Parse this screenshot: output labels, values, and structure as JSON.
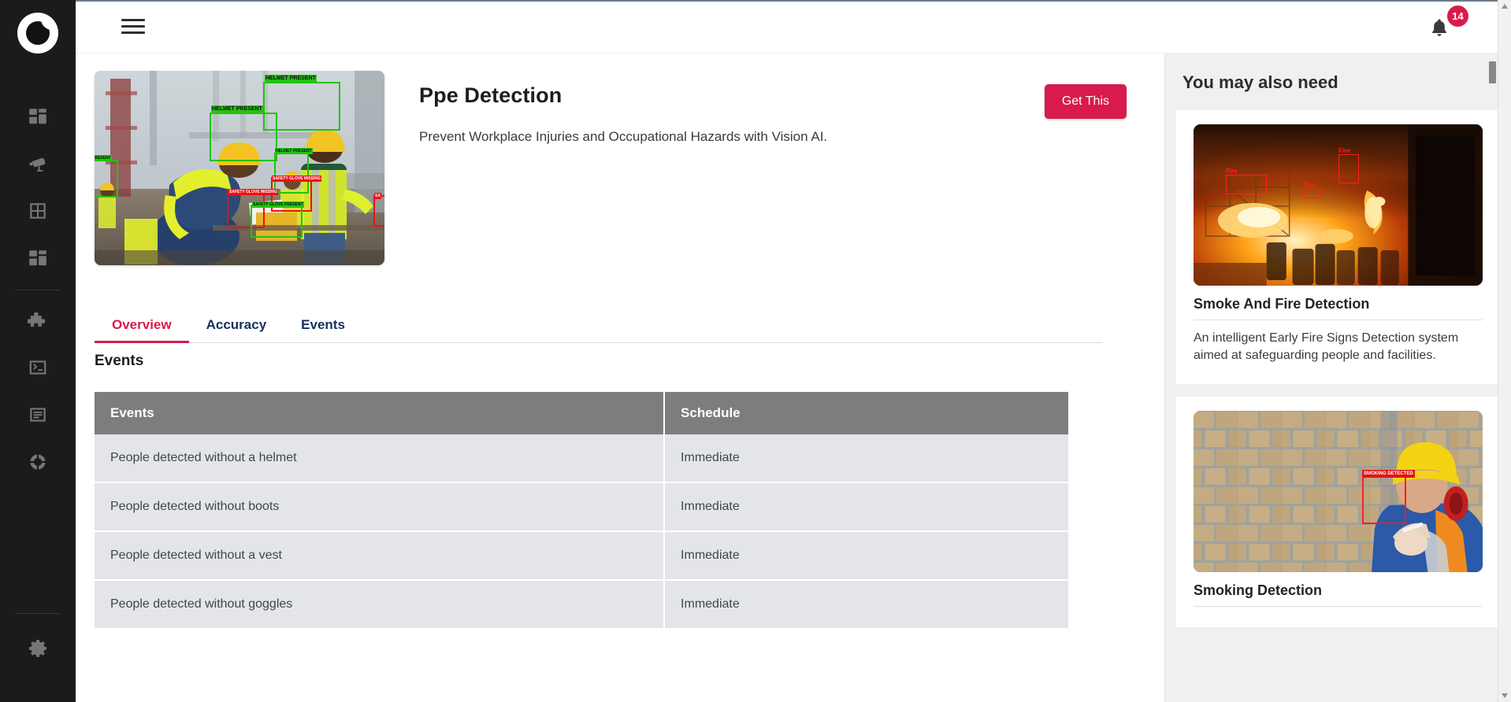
{
  "brand": {
    "logo_name": "crescent-circle-logo"
  },
  "topbar": {
    "menu_icon": "hamburger-icon",
    "notifications_icon": "bell-icon",
    "notifications_count": "14"
  },
  "sidebar": {
    "items": [
      {
        "icon": "dashboard-grid-icon",
        "name": "sidebar-item-dashboard"
      },
      {
        "icon": "cctv-camera-icon",
        "name": "sidebar-item-cameras"
      },
      {
        "icon": "window-grid-icon",
        "name": "sidebar-item-views"
      },
      {
        "icon": "layout-blocks-icon",
        "name": "sidebar-item-apps"
      },
      {
        "icon": "puzzle-piece-icon",
        "name": "sidebar-item-plugins"
      },
      {
        "icon": "terminal-icon",
        "name": "sidebar-item-terminal"
      },
      {
        "icon": "document-lines-icon",
        "name": "sidebar-item-logs"
      },
      {
        "icon": "donut-chart-icon",
        "name": "sidebar-item-analytics"
      },
      {
        "icon": "gear-icon",
        "name": "sidebar-item-settings"
      }
    ]
  },
  "hero": {
    "title": "Ppe Detection",
    "subtitle": "Prevent Workplace Injuries and Occupational Hazards with Vision AI.",
    "cta_label": "Get This",
    "image_name": "ppe-detection-preview",
    "image_detections": [
      {
        "label": "HELMET PRESENT",
        "type": "present"
      },
      {
        "label": "HELMET PRESENT",
        "type": "present"
      },
      {
        "label": "HELMET PRESENT",
        "type": "present"
      },
      {
        "label": "PRESENT",
        "type": "present"
      },
      {
        "label": "SAFETY GLOVE MISSING",
        "type": "missing"
      },
      {
        "label": "SAFETY GLOVE MISSING",
        "type": "missing"
      },
      {
        "label": "SAFETY GLOVE PRESENT",
        "type": "present"
      },
      {
        "label": "SA",
        "type": "missing"
      }
    ]
  },
  "tabs": [
    {
      "label": "Overview",
      "active": true
    },
    {
      "label": "Accuracy",
      "active": false
    },
    {
      "label": "Events",
      "active": false
    }
  ],
  "section": {
    "title": "Events"
  },
  "table": {
    "columns": [
      "Events",
      "Schedule"
    ],
    "rows": [
      [
        "People detected without a helmet",
        "Immediate"
      ],
      [
        "People detected without boots",
        "Immediate"
      ],
      [
        "People detected without a vest",
        "Immediate"
      ],
      [
        "People detected without goggles",
        "Immediate"
      ]
    ]
  },
  "right_panel": {
    "title": "You may also need",
    "cards": [
      {
        "title": "Smoke And Fire Detection",
        "description": "An intelligent Early Fire Signs Detection system aimed at safeguarding people and facilities.",
        "image_name": "smoke-fire-detection-preview",
        "image_labels": [
          "Fire",
          "Fire",
          "Fire"
        ]
      },
      {
        "title": "Smoking Detection",
        "description": "",
        "image_name": "smoking-detection-preview",
        "image_labels": [
          "SMOKING DETECTED"
        ]
      }
    ]
  },
  "colors": {
    "accent": "#d81b4c",
    "rail_bg": "#1b1b1b",
    "table_header": "#7d7d7d",
    "table_row": "#e3e5e9",
    "tab_inactive": "#17305c",
    "panel_bg": "#f0f0f0"
  }
}
